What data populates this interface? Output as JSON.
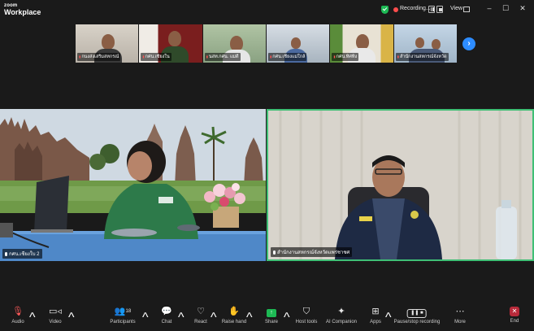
{
  "app": {
    "logo_line1": "zoom",
    "logo_line2": "Workplace"
  },
  "recording": {
    "label": "Recording...",
    "view_label": "View"
  },
  "window_controls": [
    "–",
    "☐",
    "✕"
  ],
  "thumbnails": [
    {
      "name": "กนงส่งเสริมสหกรณ์"
    },
    {
      "name": "กศน.เซียงใน"
    },
    {
      "name": "นสท.กศน. แม่ดี"
    },
    {
      "name": "กศน.เชียงแม่ใกล้"
    },
    {
      "name": "กศน.ทิศทิง"
    },
    {
      "name": "สำนักงานสหกรณ์จังหวัด"
    }
  ],
  "main_tiles": [
    {
      "name": "กศน.เชียงใบ 2"
    },
    {
      "name": "สำนักงานสหกรณ์จังหวัดแพร่ชาชศ"
    }
  ],
  "toolbar": {
    "audio": "Audio",
    "video": "Video",
    "participants": "Participants",
    "participants_count": "18",
    "chat": "Chat",
    "react": "React",
    "raise_hand": "Raise hand",
    "share": "Share",
    "host_tools": "Host tools",
    "ai_companion": "AI Companion",
    "apps": "Apps",
    "pause_stop_recording": "Pause/stop recording",
    "more": "More",
    "end": "End"
  },
  "colors": {
    "accent_blue": "#2d8cff",
    "active_speaker": "#3fbf75",
    "end_red": "#b82a3a",
    "recording_red": "#ff4d4d"
  }
}
